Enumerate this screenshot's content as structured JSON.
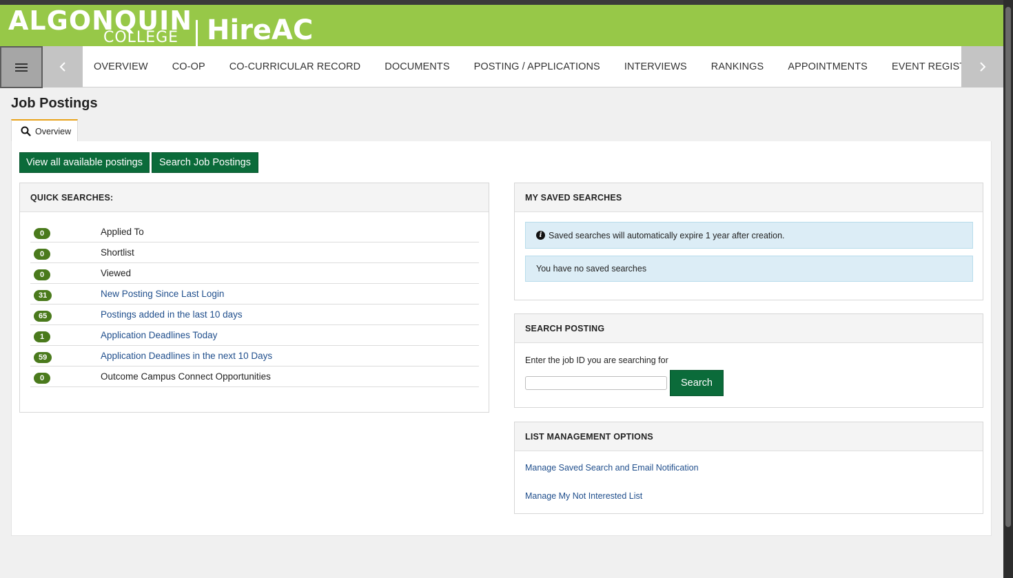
{
  "header": {
    "logo_algonquin": "ALGONQUIN",
    "logo_college": "COLLEGE",
    "app_name": "HireAC",
    "brand_color": "#97c848"
  },
  "nav": {
    "menu_icon": "hamburger-icon",
    "prev_icon": "chevron-left-icon",
    "next_icon": "chevron-right-icon",
    "items": [
      "OVERVIEW",
      "CO-OP",
      "CO-CURRICULAR RECORD",
      "DOCUMENTS",
      "POSTING / APPLICATIONS",
      "INTERVIEWS",
      "RANKINGS",
      "APPOINTMENTS",
      "EVENT REGISTRATION"
    ]
  },
  "page": {
    "title": "Job Postings",
    "tab_label": "Overview",
    "tab_accent": "#e8a21a"
  },
  "actions": {
    "view_all": "View all available postings",
    "search_postings": "Search Job Postings",
    "button_color": "#0b6b3a"
  },
  "quick_searches": {
    "heading": "QUICK SEARCHES:",
    "rows": [
      {
        "count": "0",
        "label": "Applied To",
        "link": false
      },
      {
        "count": "0",
        "label": "Shortlist",
        "link": false
      },
      {
        "count": "0",
        "label": "Viewed",
        "link": false
      },
      {
        "count": "31",
        "label": "New Posting Since Last Login",
        "link": true
      },
      {
        "count": "65",
        "label": "Postings added in the last 10 days",
        "link": true
      },
      {
        "count": "1",
        "label": "Application Deadlines Today",
        "link": true
      },
      {
        "count": "59",
        "label": "Application Deadlines in the next 10 Days",
        "link": true
      },
      {
        "count": "0",
        "label": "Outcome Campus Connect Opportunities",
        "link": false
      }
    ]
  },
  "saved_searches": {
    "heading": "MY SAVED SEARCHES",
    "expire_notice": "Saved searches will automatically expire 1 year after creation.",
    "empty_notice": "You have no saved searches"
  },
  "search_posting": {
    "heading": "SEARCH POSTING",
    "label": "Enter the job ID you are searching for",
    "input_value": "",
    "button": "Search"
  },
  "list_management": {
    "heading": "LIST MANAGEMENT OPTIONS",
    "links": [
      "Manage Saved Search and Email Notification",
      "Manage My Not Interested List"
    ]
  }
}
